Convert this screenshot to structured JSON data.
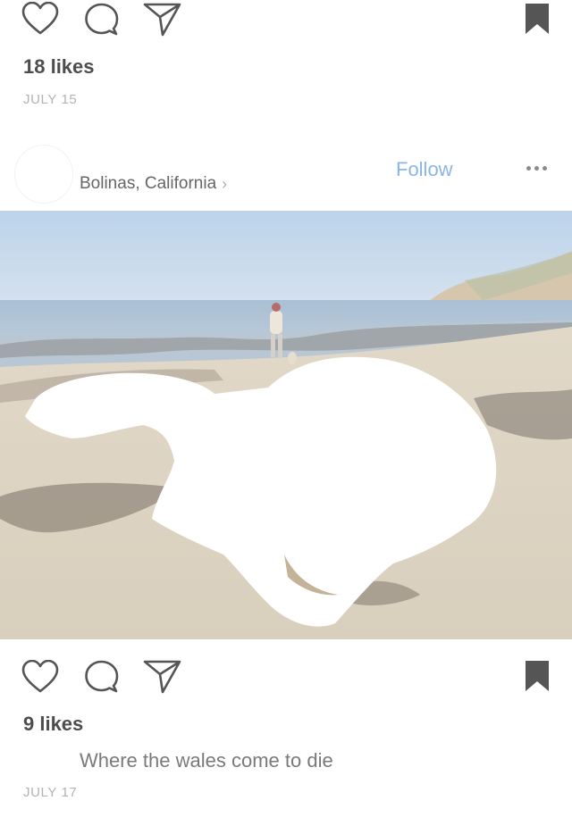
{
  "post_top": {
    "likes": "18 likes",
    "date": "JULY 15"
  },
  "post_main": {
    "location": "Bolinas, California",
    "follow_label": "Follow",
    "likes": "9 likes",
    "caption": "Where the wales come to die",
    "date": "JULY 17"
  },
  "icons": {
    "like": "heart-icon",
    "comment": "comment-icon",
    "share": "send-icon",
    "save": "bookmark-icon",
    "more": "more-icon",
    "location_chevron": "chevron-right-icon"
  },
  "colors": {
    "follow": "#8ab6e6",
    "icon": "#555555",
    "meta_text": "#b3b3b3"
  }
}
